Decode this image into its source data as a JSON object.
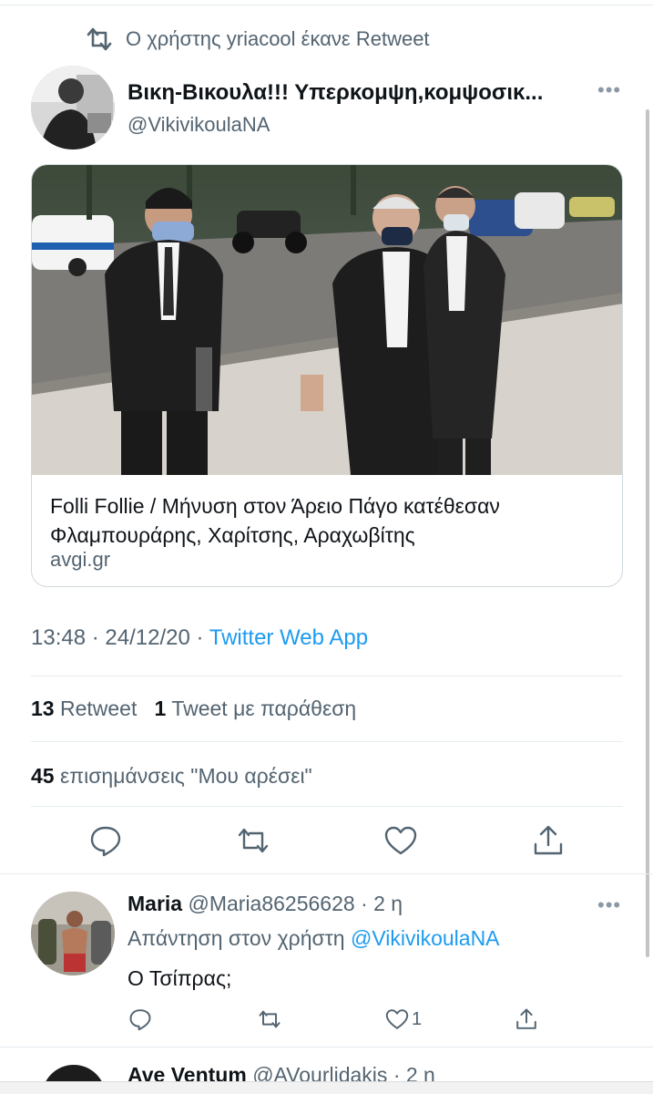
{
  "retweet_banner": {
    "text": "Ο χρήστης yriacool έκανε Retweet"
  },
  "tweet": {
    "author_name": "Βικη-Βικουλα!!! Υπερκομψη,κομψοσικ...",
    "author_handle": "@VikivikoulaNA",
    "card": {
      "title": "Folli Follie / Μήνυση στον Άρειο Πάγο κατέθεσαν Φλαμπουράρης, Χαρίτσης, Αραχωβίτης",
      "domain": "avgi.gr"
    },
    "time": "13:48",
    "separator": "·",
    "date": "24/12/20",
    "source": "Twitter Web App",
    "stats": {
      "retweets_count": "13",
      "retweets_label": "Retweet",
      "quotes_count": "1",
      "quotes_label": "Tweet με παράθεση",
      "likes_count": "45",
      "likes_label": "επισημάνσεις \"Μου αρέσει\""
    }
  },
  "reply": {
    "author_name": "Maria",
    "author_handle": "@Maria86256628",
    "time_ago": "· 2 η",
    "reply_to_prefix": "Απάντηση στον χρήστη",
    "reply_to_handle": "@VikivikoulaNA",
    "text": "Ο Τσίπρας;",
    "like_count": "1"
  },
  "next_tweet": {
    "author_name": "Ave Ventum",
    "author_handle": "@AVourlidakis",
    "time_ago": "· 2 η"
  },
  "icons": [
    "retweet-icon",
    "reply-icon",
    "like-icon",
    "share-icon",
    "more-icon"
  ],
  "colors": {
    "link": "#1d9bf0",
    "secondary": "#536471",
    "text": "#0f1419",
    "divider": "#e6ecf0"
  }
}
